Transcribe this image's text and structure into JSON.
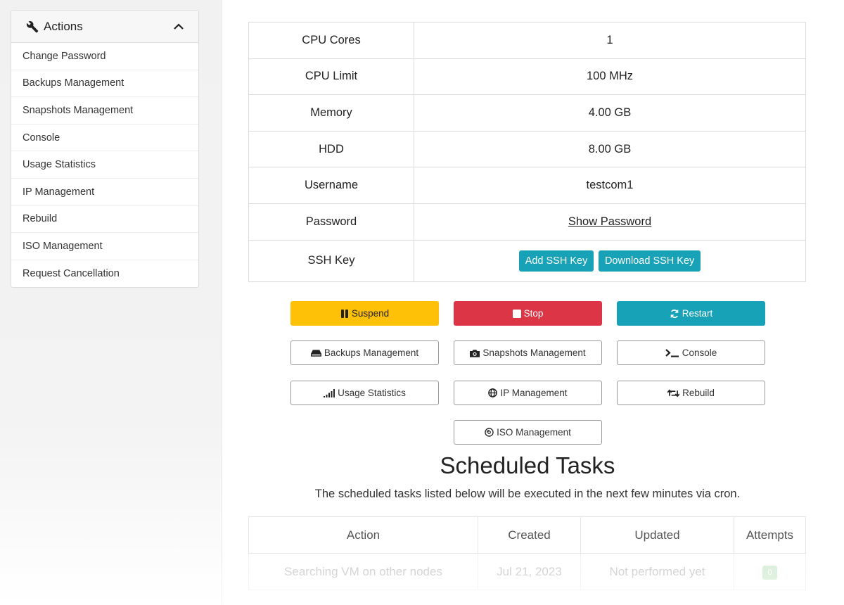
{
  "sidebar": {
    "title": "Actions",
    "items": [
      {
        "label": "Change Password"
      },
      {
        "label": "Backups Management"
      },
      {
        "label": "Snapshots Management"
      },
      {
        "label": "Console"
      },
      {
        "label": "Usage Statistics"
      },
      {
        "label": "IP Management"
      },
      {
        "label": "Rebuild"
      },
      {
        "label": "ISO Management"
      },
      {
        "label": "Request Cancellation"
      }
    ]
  },
  "info_table": {
    "rows": [
      {
        "key": "CPU Cores",
        "value": "1"
      },
      {
        "key": "CPU Limit",
        "value": "100 MHz"
      },
      {
        "key": "Memory",
        "value": "4.00 GB"
      },
      {
        "key": "HDD",
        "value": "8.00 GB"
      },
      {
        "key": "Username",
        "value": "testcom1"
      },
      {
        "key": "Password",
        "value": "Show Password"
      },
      {
        "key": "SSH Key",
        "add_label": "Add SSH Key",
        "download_label": "Download SSH Key"
      }
    ]
  },
  "actions": {
    "suspend": "Suspend",
    "stop": "Stop",
    "restart": "Restart",
    "backups": "Backups Management",
    "snapshots": "Snapshots Management",
    "console": "Console",
    "usage": "Usage Statistics",
    "ip": "IP Management",
    "rebuild": "Rebuild",
    "iso": "ISO Management"
  },
  "colors": {
    "warning": "#ffc107",
    "danger": "#dc3545",
    "info": "#17a2b8"
  },
  "scheduled": {
    "title": "Scheduled Tasks",
    "description": "The scheduled tasks listed below will be executed in the next few minutes via cron.",
    "columns": [
      "Action",
      "Created",
      "Updated",
      "Attempts"
    ],
    "rows": [
      {
        "action": "Searching VM on other nodes",
        "created": "Jul 21, 2023",
        "updated": "Not performed yet",
        "attempts": "0"
      }
    ]
  }
}
